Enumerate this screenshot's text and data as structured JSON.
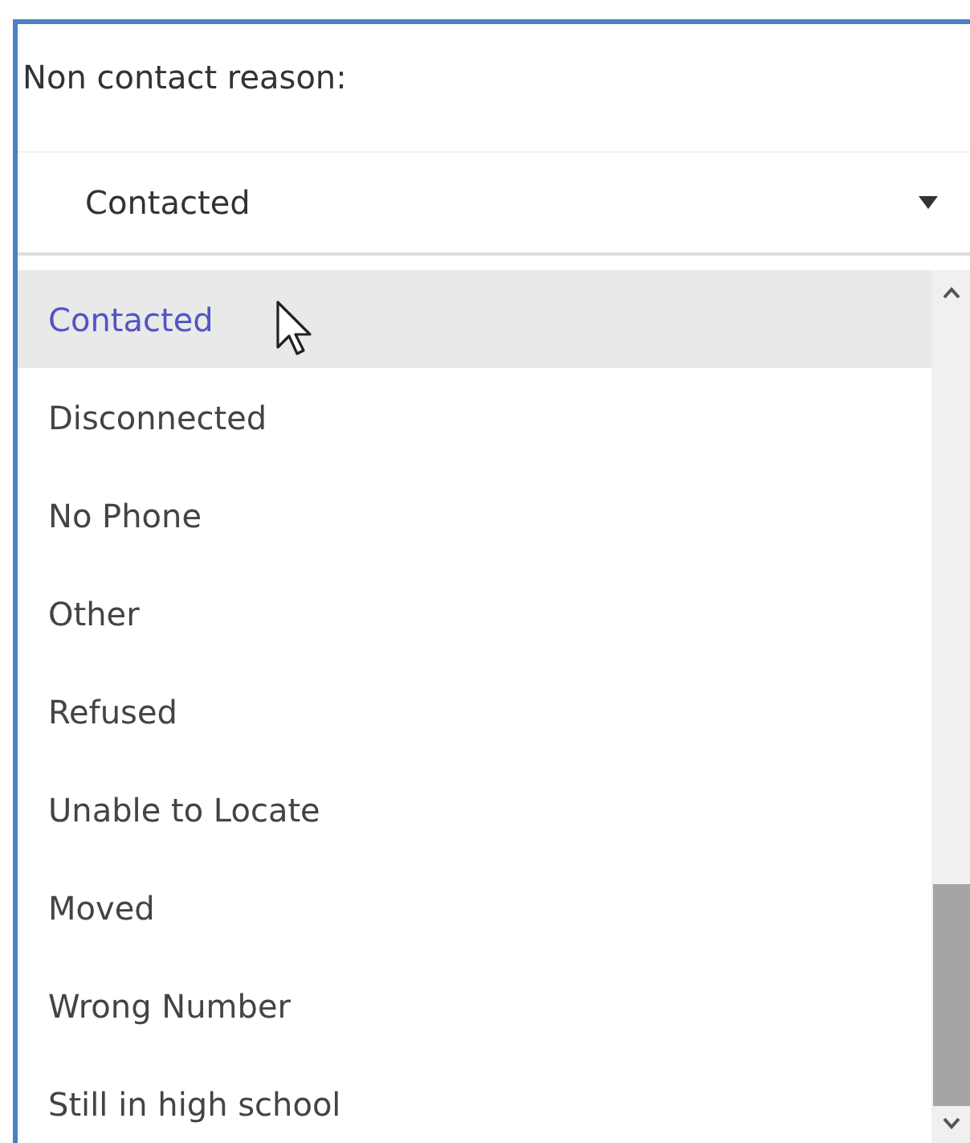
{
  "label": "Non contact reason:",
  "select": {
    "value": "Contacted"
  },
  "options": [
    {
      "label": "Contacted",
      "selected": true
    },
    {
      "label": "Disconnected",
      "selected": false
    },
    {
      "label": "No Phone",
      "selected": false
    },
    {
      "label": "Other",
      "selected": false
    },
    {
      "label": "Refused",
      "selected": false
    },
    {
      "label": "Unable to Locate",
      "selected": false
    },
    {
      "label": "Moved",
      "selected": false
    },
    {
      "label": "Wrong Number",
      "selected": false
    },
    {
      "label": "Still in high school",
      "selected": false
    }
  ]
}
